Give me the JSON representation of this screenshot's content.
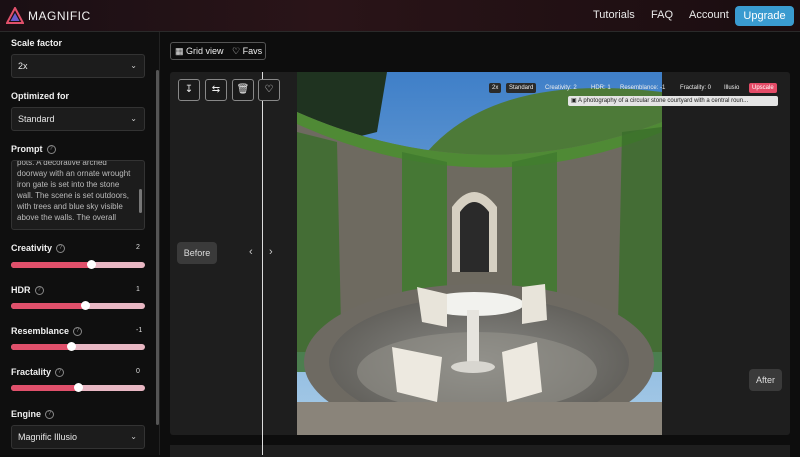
{
  "header": {
    "brand": "MAGNIFIC",
    "nav": [
      "Tutorials",
      "FAQ",
      "Account"
    ],
    "upgrade_label": "Upgrade"
  },
  "sidebar": {
    "scale_factor": {
      "label": "Scale factor",
      "value": "2x"
    },
    "optimized_for": {
      "label": "Optimized for",
      "value": "Standard"
    },
    "prompt": {
      "label": "Prompt",
      "text": "pots. A decorative arched doorway with an ornate wrought iron gate is set into the stone wall. The scene is set outdoors, with trees and blue sky visible above the walls. The overall"
    },
    "sliders": [
      {
        "label": "Creativity",
        "value": "2",
        "fraction": 0.6
      },
      {
        "label": "HDR",
        "value": "1",
        "fraction": 0.55
      },
      {
        "label": "Resemblance",
        "value": "-1",
        "fraction": 0.45
      },
      {
        "label": "Fractality",
        "value": "0",
        "fraction": 0.5
      }
    ],
    "engine": {
      "label": "Engine",
      "value": "Magnific Illusio"
    }
  },
  "viewbar": {
    "grid_label": "Grid view",
    "favs_label": "Favs"
  },
  "result": {
    "before_label": "Before",
    "after_label": "After",
    "tags": [
      "2x",
      "Standard",
      "Creativity: 2",
      "HDR: 1",
      "Resemblance: -1",
      "Fractality: 0",
      "Illusio",
      "Upscale"
    ],
    "caption": "A photography of a circular stone courtyard with a central roun..."
  },
  "icons": [
    "download-icon",
    "swap-icon",
    "trash-icon",
    "heart-icon",
    "grid-icon",
    "help-icon",
    "chevron-down-icon",
    "chevron-left-icon",
    "chevron-right-icon"
  ],
  "colors": {
    "accent": "#e0506b",
    "upgrade": "#3a9bd0",
    "background": "#0d0d0d"
  }
}
